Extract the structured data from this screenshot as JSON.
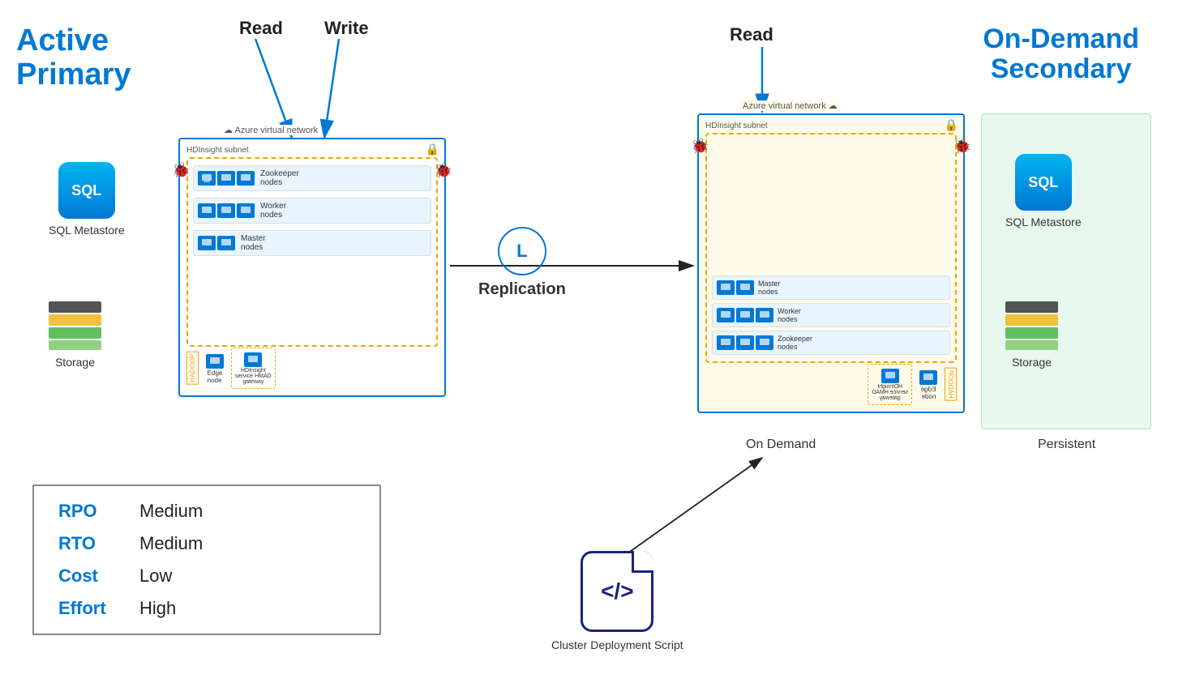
{
  "activePrimary": {
    "line1": "Active",
    "line2": "Primary"
  },
  "onDemandSecondary": {
    "line1": "On-Demand",
    "line2": "Secondary"
  },
  "readLabel": "Read",
  "writeLabel": "Write",
  "readRightLabel": "Read",
  "replication": {
    "symbol": "L",
    "label": "Replication"
  },
  "primaryCluster": {
    "vnetLabel": "Azure virtual network",
    "subnetLabel": "HDInsight subnet",
    "nodes": [
      {
        "label": "Zookeeper\nnodes",
        "count": 3
      },
      {
        "label": "Worker\nnodes",
        "count": 3
      },
      {
        "label": "Master\nnodes",
        "count": 2
      }
    ],
    "edgeLabel": "Edge\nnode",
    "gatewayLabel": "HDInsight\nservice HMAD\ngateway"
  },
  "sqlMetastore": {
    "label": "SQL",
    "sublabel": "SQL Metastore"
  },
  "storage": {
    "label": "Storage"
  },
  "metrics": [
    {
      "key": "RPO",
      "value": "Medium"
    },
    {
      "key": "RTO",
      "value": "Medium"
    },
    {
      "key": "Cost",
      "value": "Low"
    },
    {
      "key": "Effort",
      "value": "High"
    }
  ],
  "onDemandLabel": "On Demand",
  "persistentLabel": "Persistent",
  "clusterDeploymentScript": {
    "label": "Cluster Deployment Script",
    "symbol": "</>"
  }
}
